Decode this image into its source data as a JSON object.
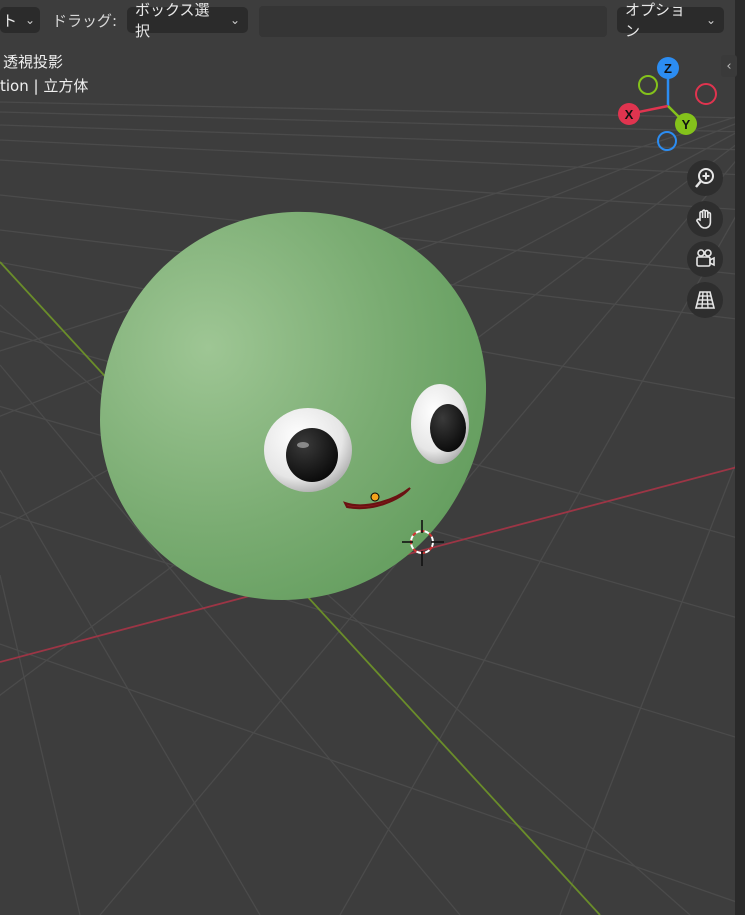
{
  "header": {
    "mode_fragment": "ト",
    "drag_label": "ドラッグ:",
    "drag_value": "ボックス選択",
    "options_label": "オプション"
  },
  "viewport_info": {
    "line1": "透視投影",
    "line2": "tion | 立方体"
  },
  "gizmo": {
    "x_label": "X",
    "y_label": "Y",
    "z_label": "Z",
    "x_color": "#e0344f",
    "y_color": "#84c21b",
    "z_color": "#2c8df2"
  },
  "nav_icons": [
    "zoom-icon",
    "pan-hand-icon",
    "camera-icon",
    "ortho-grid-icon"
  ],
  "colors": {
    "background": "#3d3d3d",
    "grid": "#4b4b4b",
    "x_axis": "#9c3545",
    "y_axis": "#6a8d2a",
    "character_body": "#7aac72",
    "mouth": "#8c1c1c"
  }
}
